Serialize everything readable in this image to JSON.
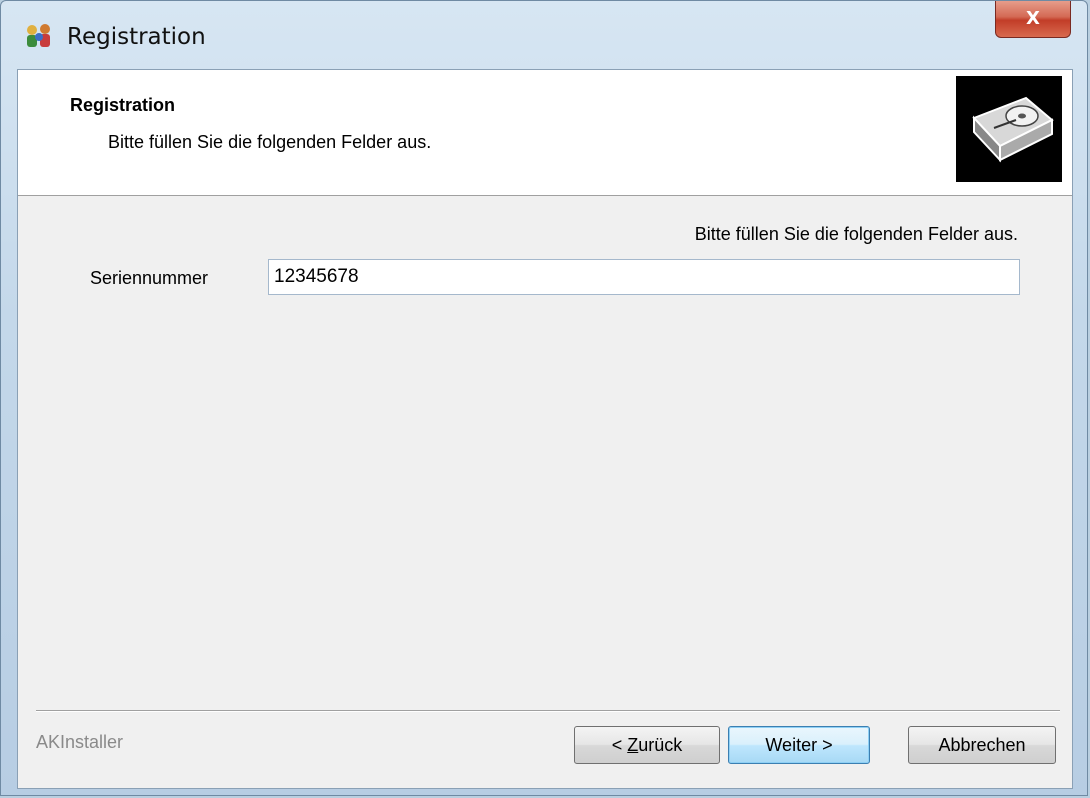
{
  "window": {
    "title": "Registration",
    "close_label": "X",
    "app_icon": "installer-people-icon"
  },
  "header": {
    "title": "Registration",
    "subtitle": "Bitte füllen Sie die folgenden Felder aus.",
    "image": "hard-drive-icon"
  },
  "body": {
    "instruction": "Bitte füllen Sie die folgenden Felder aus.",
    "serial_label": "Seriennummer",
    "serial_value": "12345678"
  },
  "footer": {
    "brand": "AKInstaller",
    "back_prefix": "< ",
    "back_mnemonic": "Z",
    "back_rest": "urück",
    "next_label": "Weiter >",
    "cancel_label": "Abbrechen"
  }
}
